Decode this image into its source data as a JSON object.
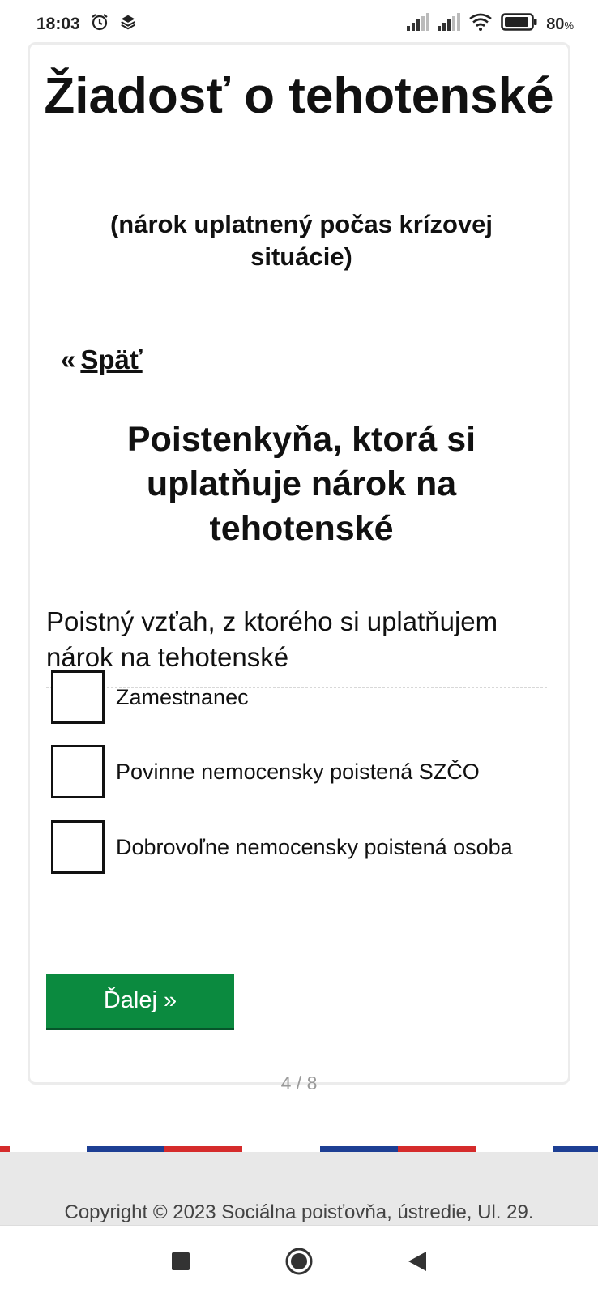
{
  "status_bar": {
    "time": "18:03",
    "battery_percent": "80",
    "battery_unit": "%",
    "icons": [
      "alarm-icon",
      "layers-icon",
      "signal-icon",
      "signal-icon",
      "wifi-icon",
      "battery-icon"
    ]
  },
  "form": {
    "title": "Žiadosť o tehotenské",
    "subtitle": "(nárok uplatnený počas krízovej situácie)",
    "back_arrow": "«",
    "back_label": "Späť",
    "section_title": "Poistenkyňa, ktorá si uplatňuje nárok na tehotenské",
    "question": "Poistný vzťah, z ktorého si uplatňujem nárok na tehotenské",
    "options": [
      {
        "label": "Zamestnanec",
        "checked": false
      },
      {
        "label": "Povinne nemocensky poistená SZČO",
        "checked": false
      },
      {
        "label": "Dobrovoľne nemocensky poistená osoba",
        "checked": false
      }
    ],
    "next_label": "Ďalej »",
    "page_counter": "4 / 8"
  },
  "footer": {
    "copyright": "Copyright © 2023 Sociálna poisťovňa, ústredie, Ul. 29."
  },
  "colors": {
    "primary_green": "#0b8a3f",
    "flag_blue": "#1d3f94",
    "flag_red": "#d52b2b"
  },
  "nav_bar": {
    "buttons": [
      "recents-icon",
      "home-icon",
      "back-icon"
    ]
  }
}
